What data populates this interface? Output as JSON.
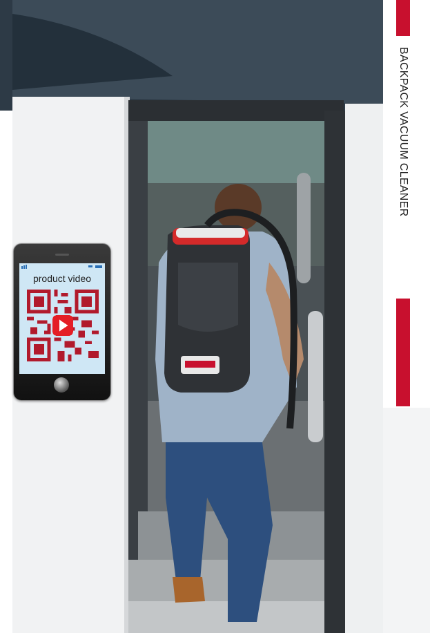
{
  "phone": {
    "caption": "product video"
  },
  "side": {
    "title": "BACKPACK VACUUM CLEANER"
  },
  "colors": {
    "accent": "#c8102e",
    "qr": "#b11a2c",
    "phone_screen": "#cfe7f5"
  }
}
